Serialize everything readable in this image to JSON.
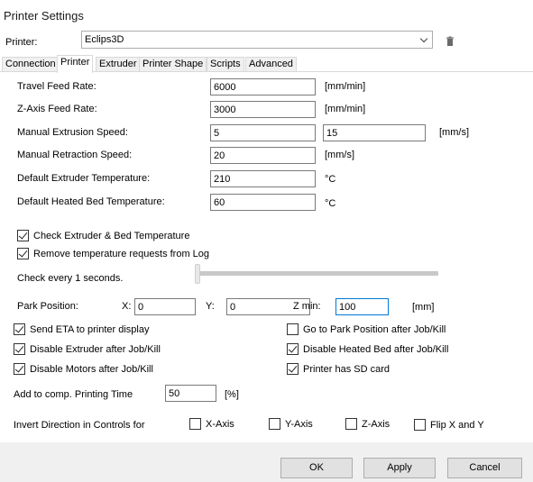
{
  "window": {
    "title": "Printer Settings"
  },
  "printer": {
    "label": "Printer:",
    "selected": "Eclips3D"
  },
  "tabs": [
    {
      "label": "Connection"
    },
    {
      "label": "Printer"
    },
    {
      "label": "Extruder"
    },
    {
      "label": "Printer Shape"
    },
    {
      "label": "Scripts"
    },
    {
      "label": "Advanced"
    }
  ],
  "settings": {
    "travel_feed": {
      "label": "Travel Feed Rate:",
      "value": "6000",
      "unit": "[mm/min]"
    },
    "zaxis_feed": {
      "label": "Z-Axis Feed Rate:",
      "value": "3000",
      "unit": "[mm/min]"
    },
    "manual_extrusion": {
      "label": "Manual Extrusion Speed:",
      "value": "5",
      "value2": "15",
      "unit": "[mm/s]"
    },
    "manual_retraction": {
      "label": "Manual Retraction Speed:",
      "value": "20",
      "unit": "[mm/s]"
    },
    "extruder_temp": {
      "label": "Default Extruder Temperature:",
      "value": "210",
      "unit": "°C"
    },
    "bed_temp": {
      "label": "Default Heated Bed Temperature:",
      "value": "60",
      "unit": "°C"
    }
  },
  "checks": {
    "check_temp": {
      "label": "Check Extruder & Bed Temperature",
      "checked": true
    },
    "remove_temp_log": {
      "label": "Remove temperature requests from Log",
      "checked": true
    },
    "send_eta": {
      "label": "Send ETA to printer display",
      "checked": true
    },
    "goto_park": {
      "label": "Go to Park Position after Job/Kill",
      "checked": false
    },
    "disable_extruder": {
      "label": "Disable Extruder after Job/Kill",
      "checked": true
    },
    "disable_bed": {
      "label": "Disable Heated Bed after Job/Kill",
      "checked": true
    },
    "disable_motors": {
      "label": "Disable Motors after Job/Kill",
      "checked": true
    },
    "sd_card": {
      "label": "Printer has SD card",
      "checked": true
    }
  },
  "check_interval": {
    "label": "Check every 1 seconds.",
    "slider_fraction": 0
  },
  "park": {
    "label": "Park Position:",
    "x_label": "X:",
    "x_value": "0",
    "y_label": "Y:",
    "y_value": "0",
    "zmin_label": "Z min:",
    "zmin_value": "100",
    "unit": "[mm]"
  },
  "comp_time": {
    "label": "Add to comp. Printing Time",
    "value": "50",
    "unit": "[%]"
  },
  "invert": {
    "label": "Invert Direction in Controls for",
    "x_axis": "X-Axis",
    "y_axis": "Y-Axis",
    "z_axis": "Z-Axis",
    "flip_xy": "Flip X and Y"
  },
  "buttons": {
    "ok": "OK",
    "apply": "Apply",
    "cancel": "Cancel"
  }
}
